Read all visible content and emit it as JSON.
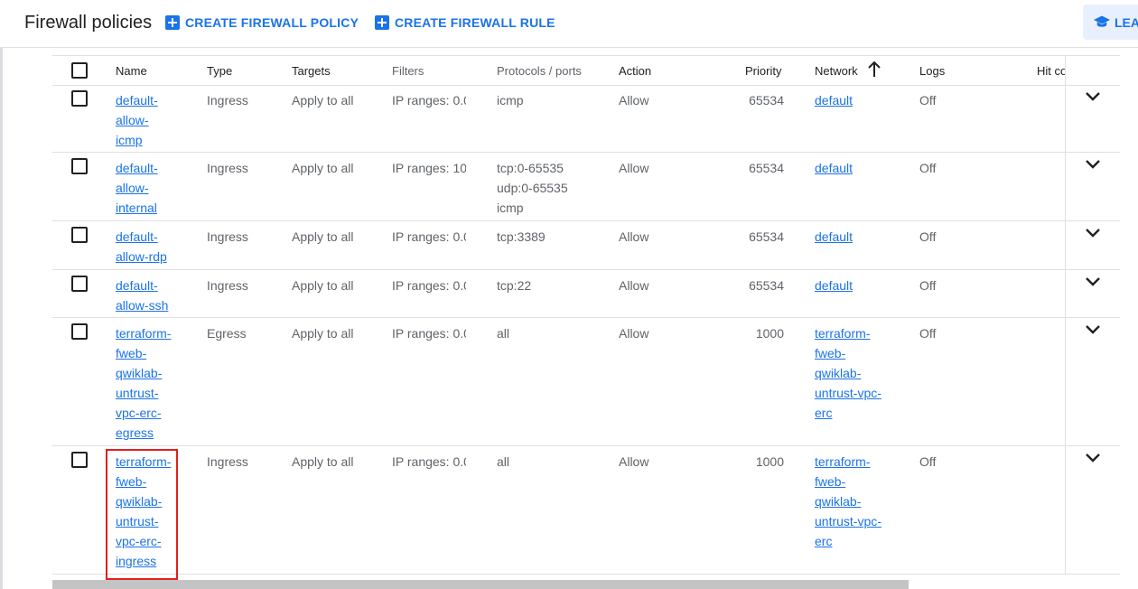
{
  "header": {
    "title": "Firewall policies",
    "create_policy_label": "CREATE FIREWALL POLICY",
    "create_rule_label": "CREATE FIREWALL RULE",
    "learn_label": "LEA"
  },
  "table": {
    "columns": {
      "name": "Name",
      "type": "Type",
      "targets": "Targets",
      "filters": "Filters",
      "protocols": "Protocols / ports",
      "action": "Action",
      "priority": "Priority",
      "network": "Network",
      "logs": "Logs",
      "hit": "Hit co"
    },
    "rows": [
      {
        "name": "default-\nallow-\nicmp",
        "type": "Ingress",
        "targets": "Apply to all",
        "filters": "IP ranges: 0.0",
        "protocols": "icmp",
        "action": "Allow",
        "priority": "65534",
        "network": "default",
        "logs": "Off"
      },
      {
        "name": "default-\nallow-\ninternal",
        "type": "Ingress",
        "targets": "Apply to all",
        "filters": "IP ranges: 10",
        "protocols": "tcp:0-65535\nudp:0-65535\nicmp",
        "action": "Allow",
        "priority": "65534",
        "network": "default",
        "logs": "Off"
      },
      {
        "name": "default-\nallow-rdp",
        "type": "Ingress",
        "targets": "Apply to all",
        "filters": "IP ranges: 0.0",
        "protocols": "tcp:3389",
        "action": "Allow",
        "priority": "65534",
        "network": "default",
        "logs": "Off"
      },
      {
        "name": "default-\nallow-ssh",
        "type": "Ingress",
        "targets": "Apply to all",
        "filters": "IP ranges: 0.0",
        "protocols": "tcp:22",
        "action": "Allow",
        "priority": "65534",
        "network": "default",
        "logs": "Off"
      },
      {
        "name": "terraform-\nfweb-\nqwiklab-\nuntrust-\nvpc-erc-\negress",
        "type": "Egress",
        "targets": "Apply to all",
        "filters": "IP ranges: 0.0",
        "protocols": "all",
        "action": "Allow",
        "priority": "1000",
        "network": "terraform-\nfweb-\nqwiklab-\nuntrust-vpc-\nerc",
        "logs": "Off"
      },
      {
        "name": "terraform-\nfweb-\nqwiklab-\nuntrust-\nvpc-erc-\ningress",
        "type": "Ingress",
        "targets": "Apply to all",
        "filters": "IP ranges: 0.0",
        "protocols": "all",
        "action": "Allow",
        "priority": "1000",
        "network": "terraform-\nfweb-\nqwiklab-\nuntrust-vpc-\nerc",
        "logs": "Off"
      }
    ]
  },
  "colors": {
    "accent": "#1a73e8",
    "highlight": "#e0201f",
    "text_muted": "#5f6368",
    "divider": "#e0e0e0"
  }
}
